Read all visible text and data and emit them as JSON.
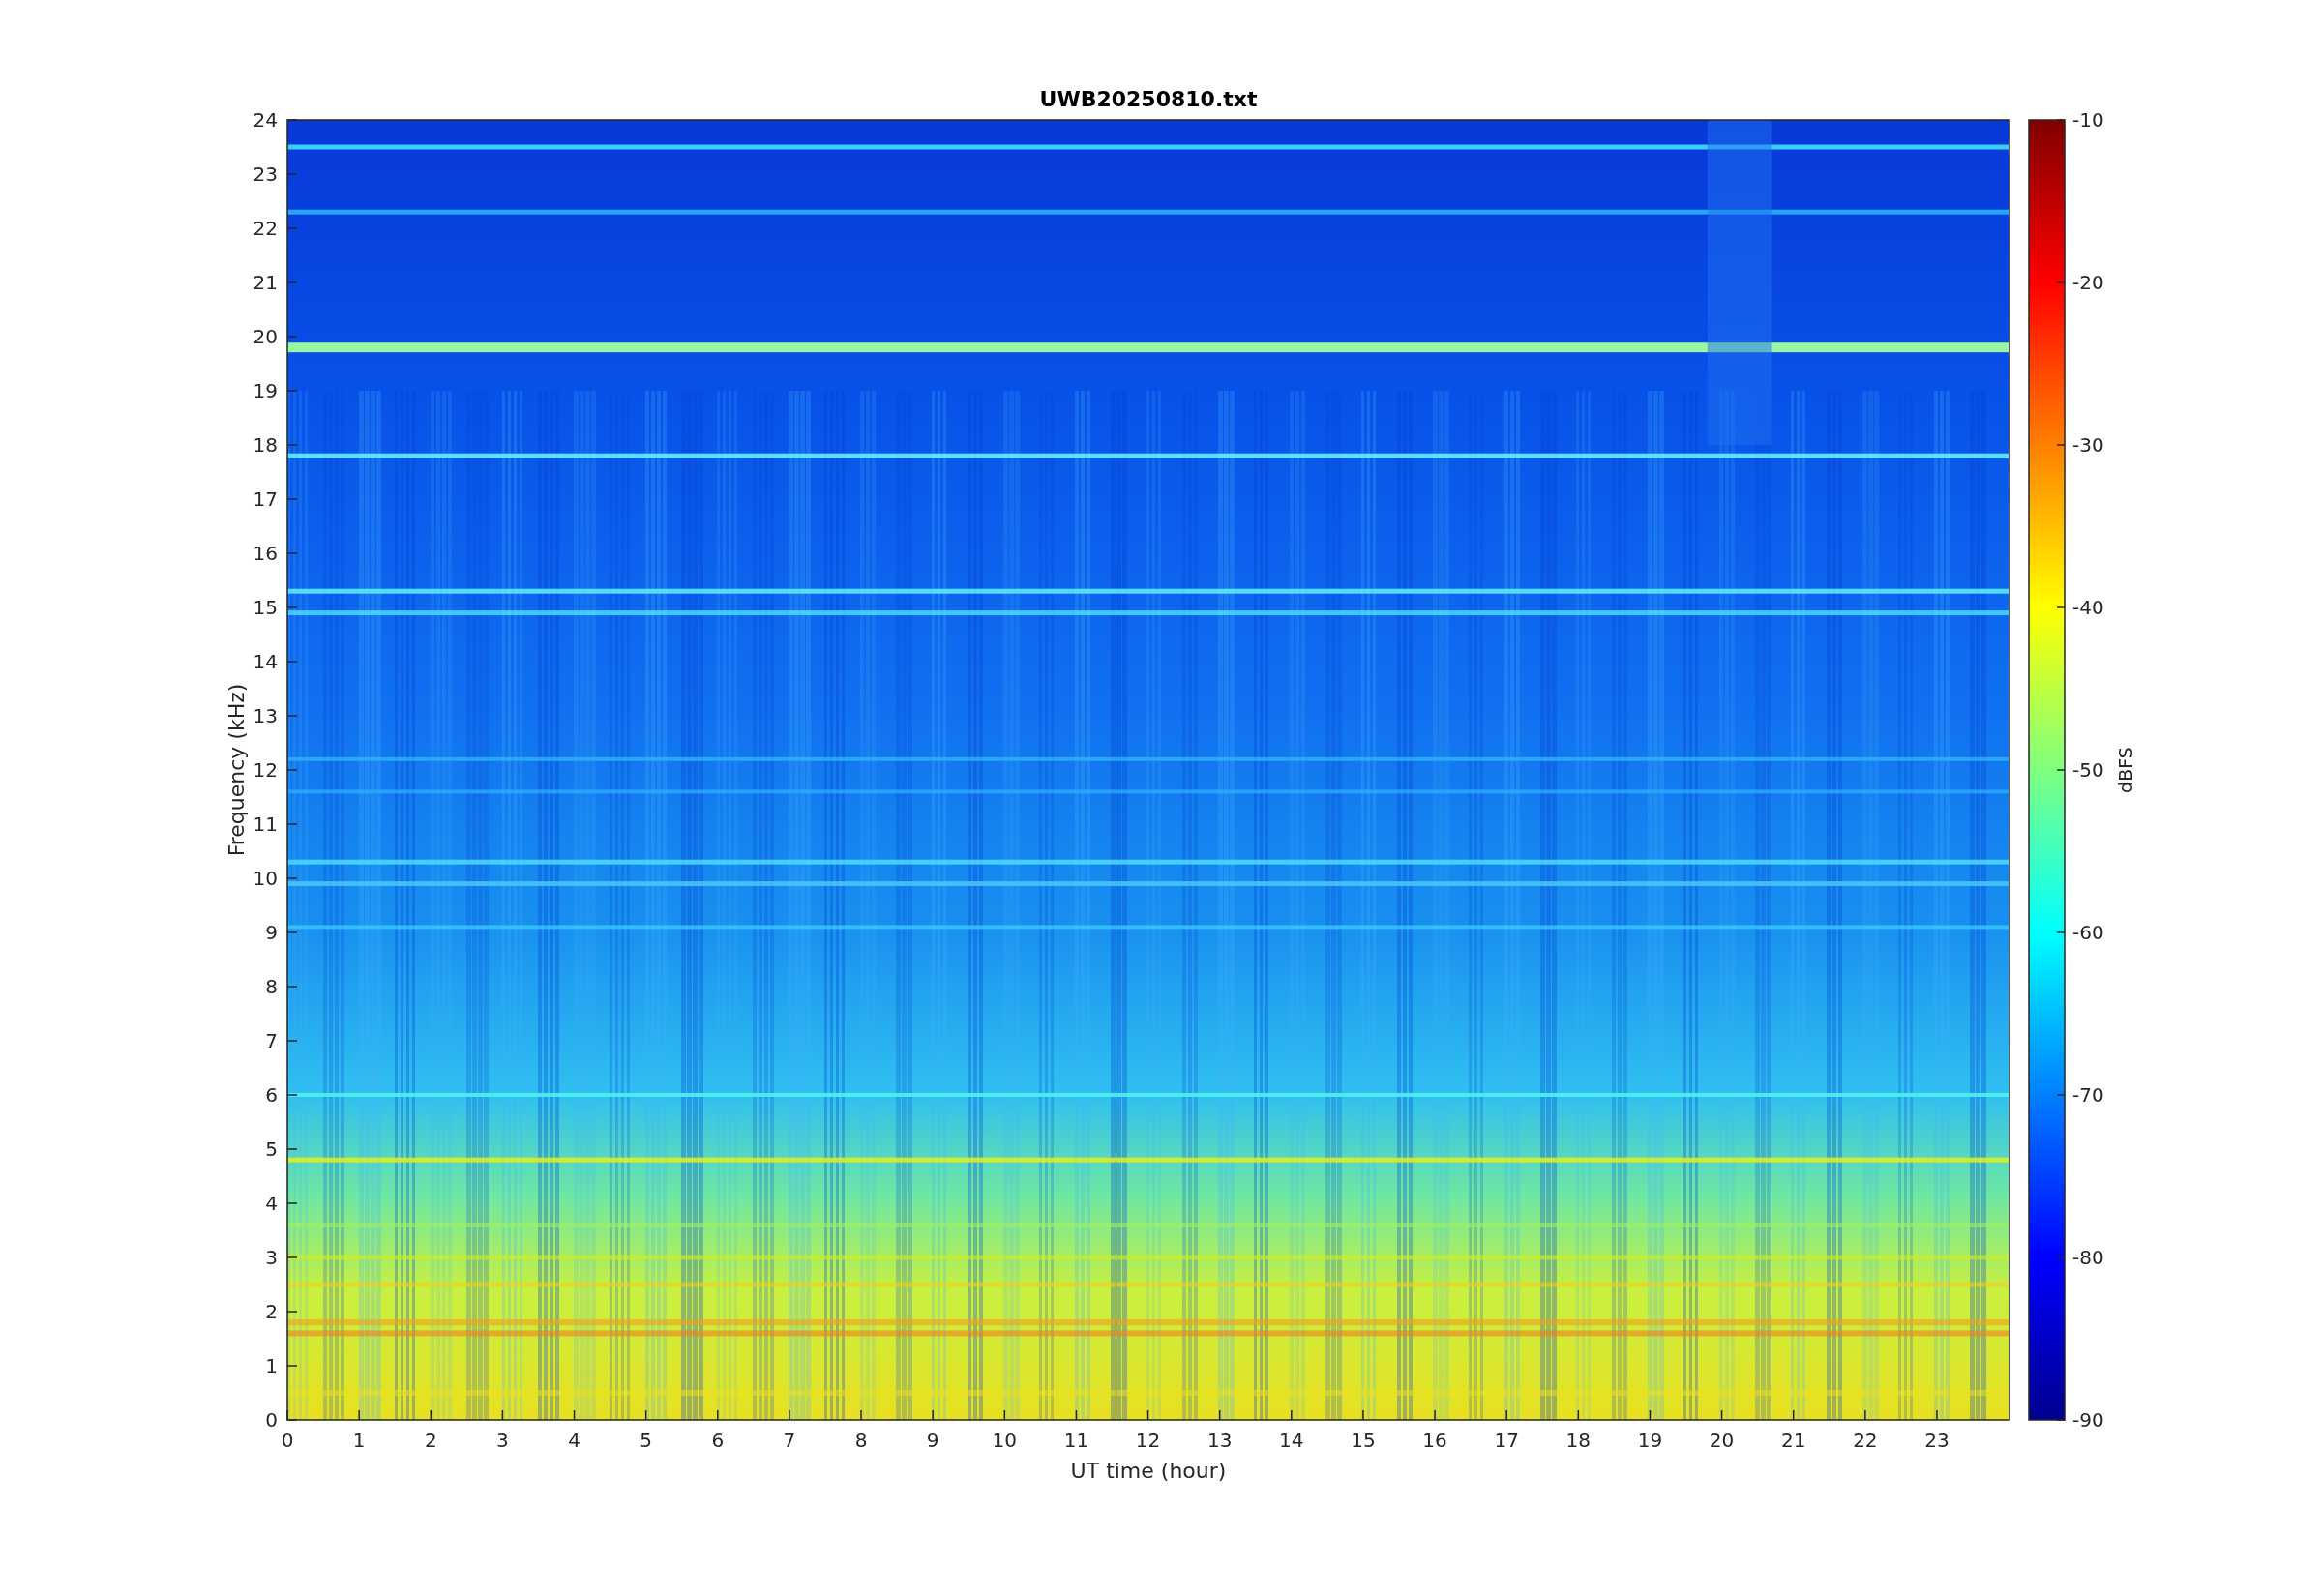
{
  "figure": {
    "title": "UWB20250810.txt",
    "xlabel": "UT time (hour)",
    "ylabel": "Frequency (kHz)",
    "xticks": [
      "0",
      "1",
      "2",
      "3",
      "4",
      "5",
      "6",
      "7",
      "8",
      "9",
      "10",
      "11",
      "12",
      "13",
      "14",
      "15",
      "16",
      "17",
      "18",
      "19",
      "20",
      "21",
      "22",
      "23"
    ],
    "yticks": [
      "24",
      "23",
      "22",
      "21",
      "20",
      "19",
      "18",
      "17",
      "16",
      "15",
      "14",
      "13",
      "12",
      "11",
      "10",
      "9",
      "8",
      "7",
      "6",
      "5",
      "4",
      "3",
      "2",
      "1",
      "0"
    ]
  },
  "colorbar": {
    "label": "dBFS",
    "ticks": [
      "-10",
      "-20",
      "-30",
      "-40",
      "-50",
      "-60",
      "-70",
      "-80",
      "-90"
    ]
  }
}
